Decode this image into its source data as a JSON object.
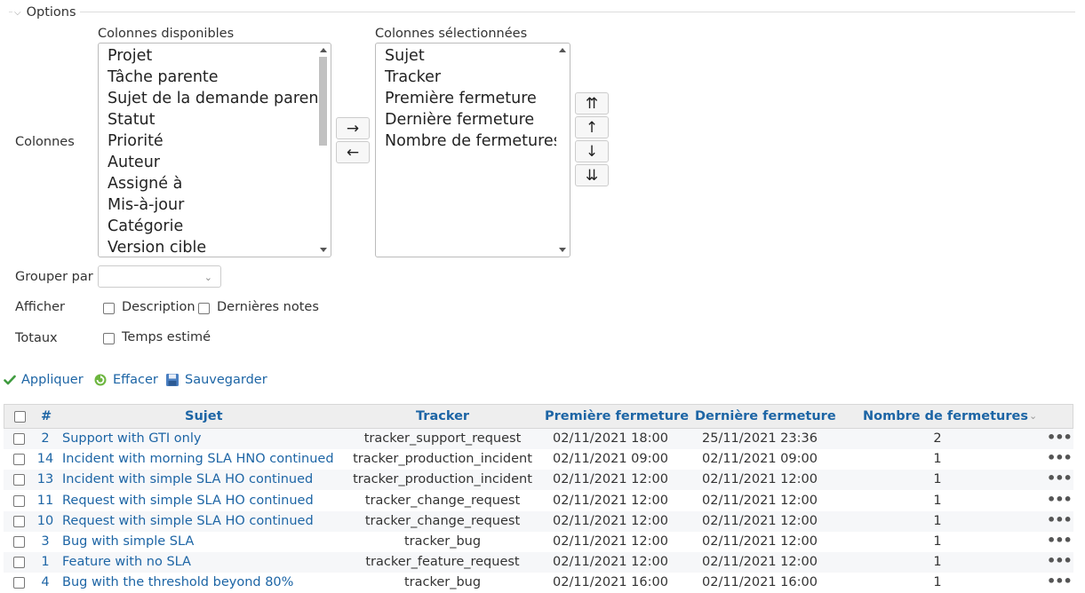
{
  "options": {
    "legend": "Options"
  },
  "columns": {
    "label": "Colonnes",
    "available_title": "Colonnes disponibles",
    "available": [
      "Projet",
      "Tâche parente",
      "Sujet de la demande parent",
      "Statut",
      "Priorité",
      "Auteur",
      "Assigné à",
      "Mis-à-jour",
      "Catégorie",
      "Version cible"
    ],
    "selected_title": "Colonnes sélectionnées",
    "selected": [
      "Sujet",
      "Tracker",
      "Première fermeture",
      "Dernière fermeture",
      "Nombre de fermetures"
    ],
    "add_btn": "→",
    "remove_btn": "←",
    "top_btn": "⇈",
    "up_btn": "↑",
    "down_btn": "↓",
    "bottom_btn": "⇊"
  },
  "group_by": {
    "label": "Grouper par",
    "value": ""
  },
  "afficher": {
    "label": "Afficher",
    "opt1": "Description",
    "opt2": "Dernières notes"
  },
  "totaux": {
    "label": "Totaux",
    "opt1": "Temps estimé"
  },
  "actions": {
    "apply": "Appliquer",
    "clear": "Effacer",
    "save": "Sauvegarder"
  },
  "table": {
    "headers": {
      "id": "#",
      "subject": "Sujet",
      "tracker": "Tracker",
      "first_close": "Première fermeture",
      "last_close": "Dernière fermeture",
      "count": "Nombre de fermetures"
    },
    "rows": [
      {
        "id": "2",
        "subject": "Support with GTI only",
        "tracker": "tracker_support_request",
        "first": "02/11/2021 18:00",
        "last": "25/11/2021 23:36",
        "count": "2"
      },
      {
        "id": "14",
        "subject": "Incident with morning SLA HNO continued",
        "tracker": "tracker_production_incident",
        "first": "02/11/2021 09:00",
        "last": "02/11/2021 09:00",
        "count": "1"
      },
      {
        "id": "13",
        "subject": "Incident with simple SLA HO continued",
        "tracker": "tracker_production_incident",
        "first": "02/11/2021 12:00",
        "last": "02/11/2021 12:00",
        "count": "1"
      },
      {
        "id": "11",
        "subject": "Request with simple SLA HO continued",
        "tracker": "tracker_change_request",
        "first": "02/11/2021 12:00",
        "last": "02/11/2021 12:00",
        "count": "1"
      },
      {
        "id": "10",
        "subject": "Request with simple SLA HO continued",
        "tracker": "tracker_change_request",
        "first": "02/11/2021 12:00",
        "last": "02/11/2021 12:00",
        "count": "1"
      },
      {
        "id": "3",
        "subject": "Bug with simple SLA",
        "tracker": "tracker_bug",
        "first": "02/11/2021 12:00",
        "last": "02/11/2021 12:00",
        "count": "1"
      },
      {
        "id": "1",
        "subject": "Feature with no SLA",
        "tracker": "tracker_feature_request",
        "first": "02/11/2021 12:00",
        "last": "02/11/2021 12:00",
        "count": "1"
      },
      {
        "id": "4",
        "subject": "Bug with the threshold beyond 80%",
        "tracker": "tracker_bug",
        "first": "02/11/2021 16:00",
        "last": "02/11/2021 16:00",
        "count": "1"
      }
    ],
    "row_menu": "•••"
  }
}
